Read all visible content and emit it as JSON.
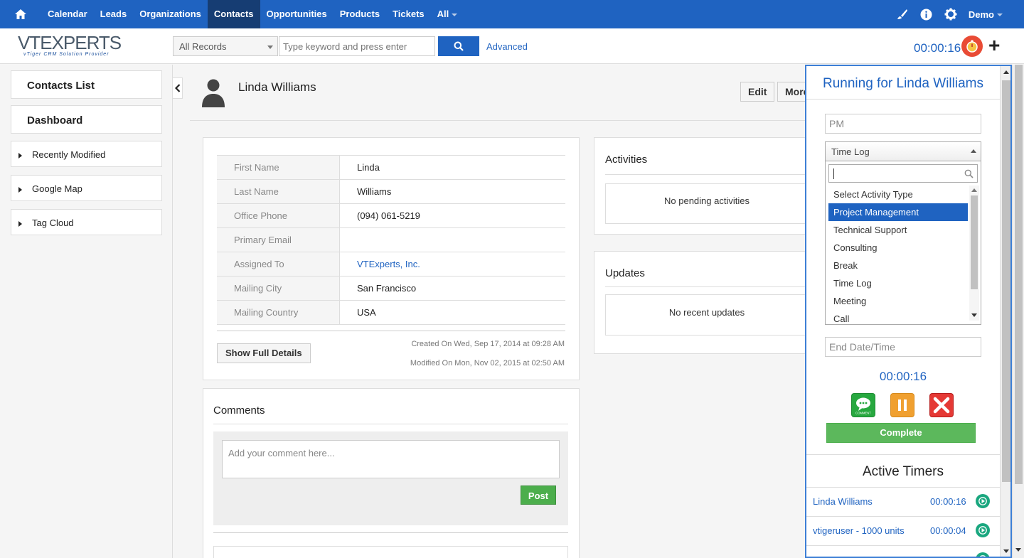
{
  "topnav": {
    "items": [
      "Calendar",
      "Leads",
      "Organizations",
      "Contacts",
      "Opportunities",
      "Products",
      "Tickets",
      "All"
    ],
    "active": "Contacts",
    "user": "Demo"
  },
  "header": {
    "logo_brand": "VTEXPERTS",
    "logo_tag": "vTiger CRM Solution Provider",
    "search_scope": "All Records",
    "search_placeholder": "Type keyword and press enter",
    "advanced": "Advanced",
    "timer": "00:00:16"
  },
  "sidebar": {
    "items": [
      "Contacts List",
      "Dashboard",
      "Recently Modified",
      "Google Map",
      "Tag Cloud"
    ]
  },
  "record": {
    "name": "Linda Williams",
    "edit": "Edit",
    "more": "More",
    "fields": [
      {
        "label": "First Name",
        "value": "Linda"
      },
      {
        "label": "Last Name",
        "value": "Williams"
      },
      {
        "label": "Office Phone",
        "value": "(094) 061-5219"
      },
      {
        "label": "Primary Email",
        "value": ""
      },
      {
        "label": "Assigned To",
        "value": "VTExperts, Inc."
      },
      {
        "label": "Mailing City",
        "value": "San Francisco"
      },
      {
        "label": "Mailing Country",
        "value": "USA"
      }
    ],
    "show_full": "Show Full Details",
    "created": "Created On Wed, Sep 17, 2014 at 09:28 AM",
    "modified": "Modified On Mon, Nov 02, 2015 at 02:50 AM"
  },
  "activities": {
    "title": "Activities",
    "empty": "No pending activities"
  },
  "updates": {
    "title": "Updates",
    "empty": "No recent updates"
  },
  "comments": {
    "title": "Comments",
    "placeholder": "Add your comment here...",
    "post": "Post"
  },
  "timer_panel": {
    "title": "Running for Linda Williams",
    "pm_field": "PM",
    "select_value": "Time Log",
    "options": [
      "Select Activity Type",
      "Project Management",
      "Technical Support",
      "Consulting",
      "Break",
      "Time Log",
      "Meeting",
      "Call"
    ],
    "selected_option": "Project Management",
    "end_placeholder": "End Date/Time",
    "elapsed": "00:00:16",
    "comment_icon_label": "COMMENT",
    "complete": "Complete",
    "active_title": "Active Timers",
    "active_timers": [
      {
        "name": "Linda Williams",
        "time": "00:00:16"
      },
      {
        "name": "vtigeruser - 1000 units",
        "time": "00:00:04"
      }
    ]
  },
  "colors": {
    "primary": "#1f63c1",
    "green": "#5cb85c",
    "orange": "#f0a030",
    "red": "#e94b35"
  }
}
